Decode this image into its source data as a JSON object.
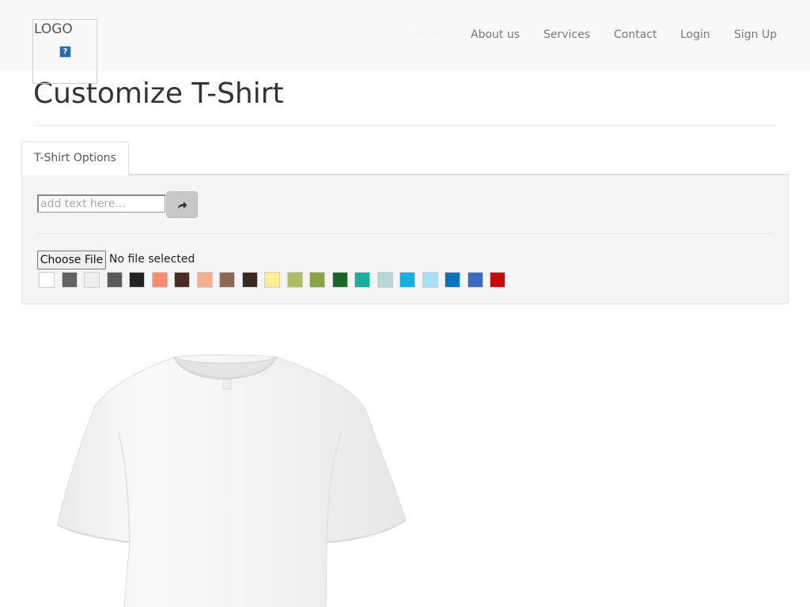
{
  "header": {
    "logo_text": "LOGO",
    "logo_image_alt": "?",
    "nav": [
      {
        "label": "Home",
        "active": true
      },
      {
        "label": "About us"
      },
      {
        "label": "Services"
      },
      {
        "label": "Contact"
      },
      {
        "label": "Login"
      },
      {
        "label": "Sign Up"
      }
    ]
  },
  "page": {
    "title": "Customize T-Shirt"
  },
  "tabs": [
    {
      "label": "T-Shirt Options",
      "selected": true
    }
  ],
  "options": {
    "text_placeholder": "add text here...",
    "add_text_icon": "share-arrow-icon",
    "file_button_label": "Choose File",
    "file_status": "No file selected",
    "colors": [
      "#ffffff",
      "#636363",
      "#eeeeee",
      "#5a5a5a",
      "#222222",
      "#fc8a6e",
      "#4a2b25",
      "#f3ad91",
      "#8a6957",
      "#372b1f",
      "#fbef92",
      "#aebd62",
      "#89a442",
      "#1c6427",
      "#15b09c",
      "#b8d5d8",
      "#14aee0",
      "#a8dffb",
      "#0c73ba",
      "#3b6cc1",
      "#c70a0a"
    ]
  },
  "preview": {
    "shirt_color": "#ffffff",
    "shirt_icon": "tshirt-image"
  }
}
